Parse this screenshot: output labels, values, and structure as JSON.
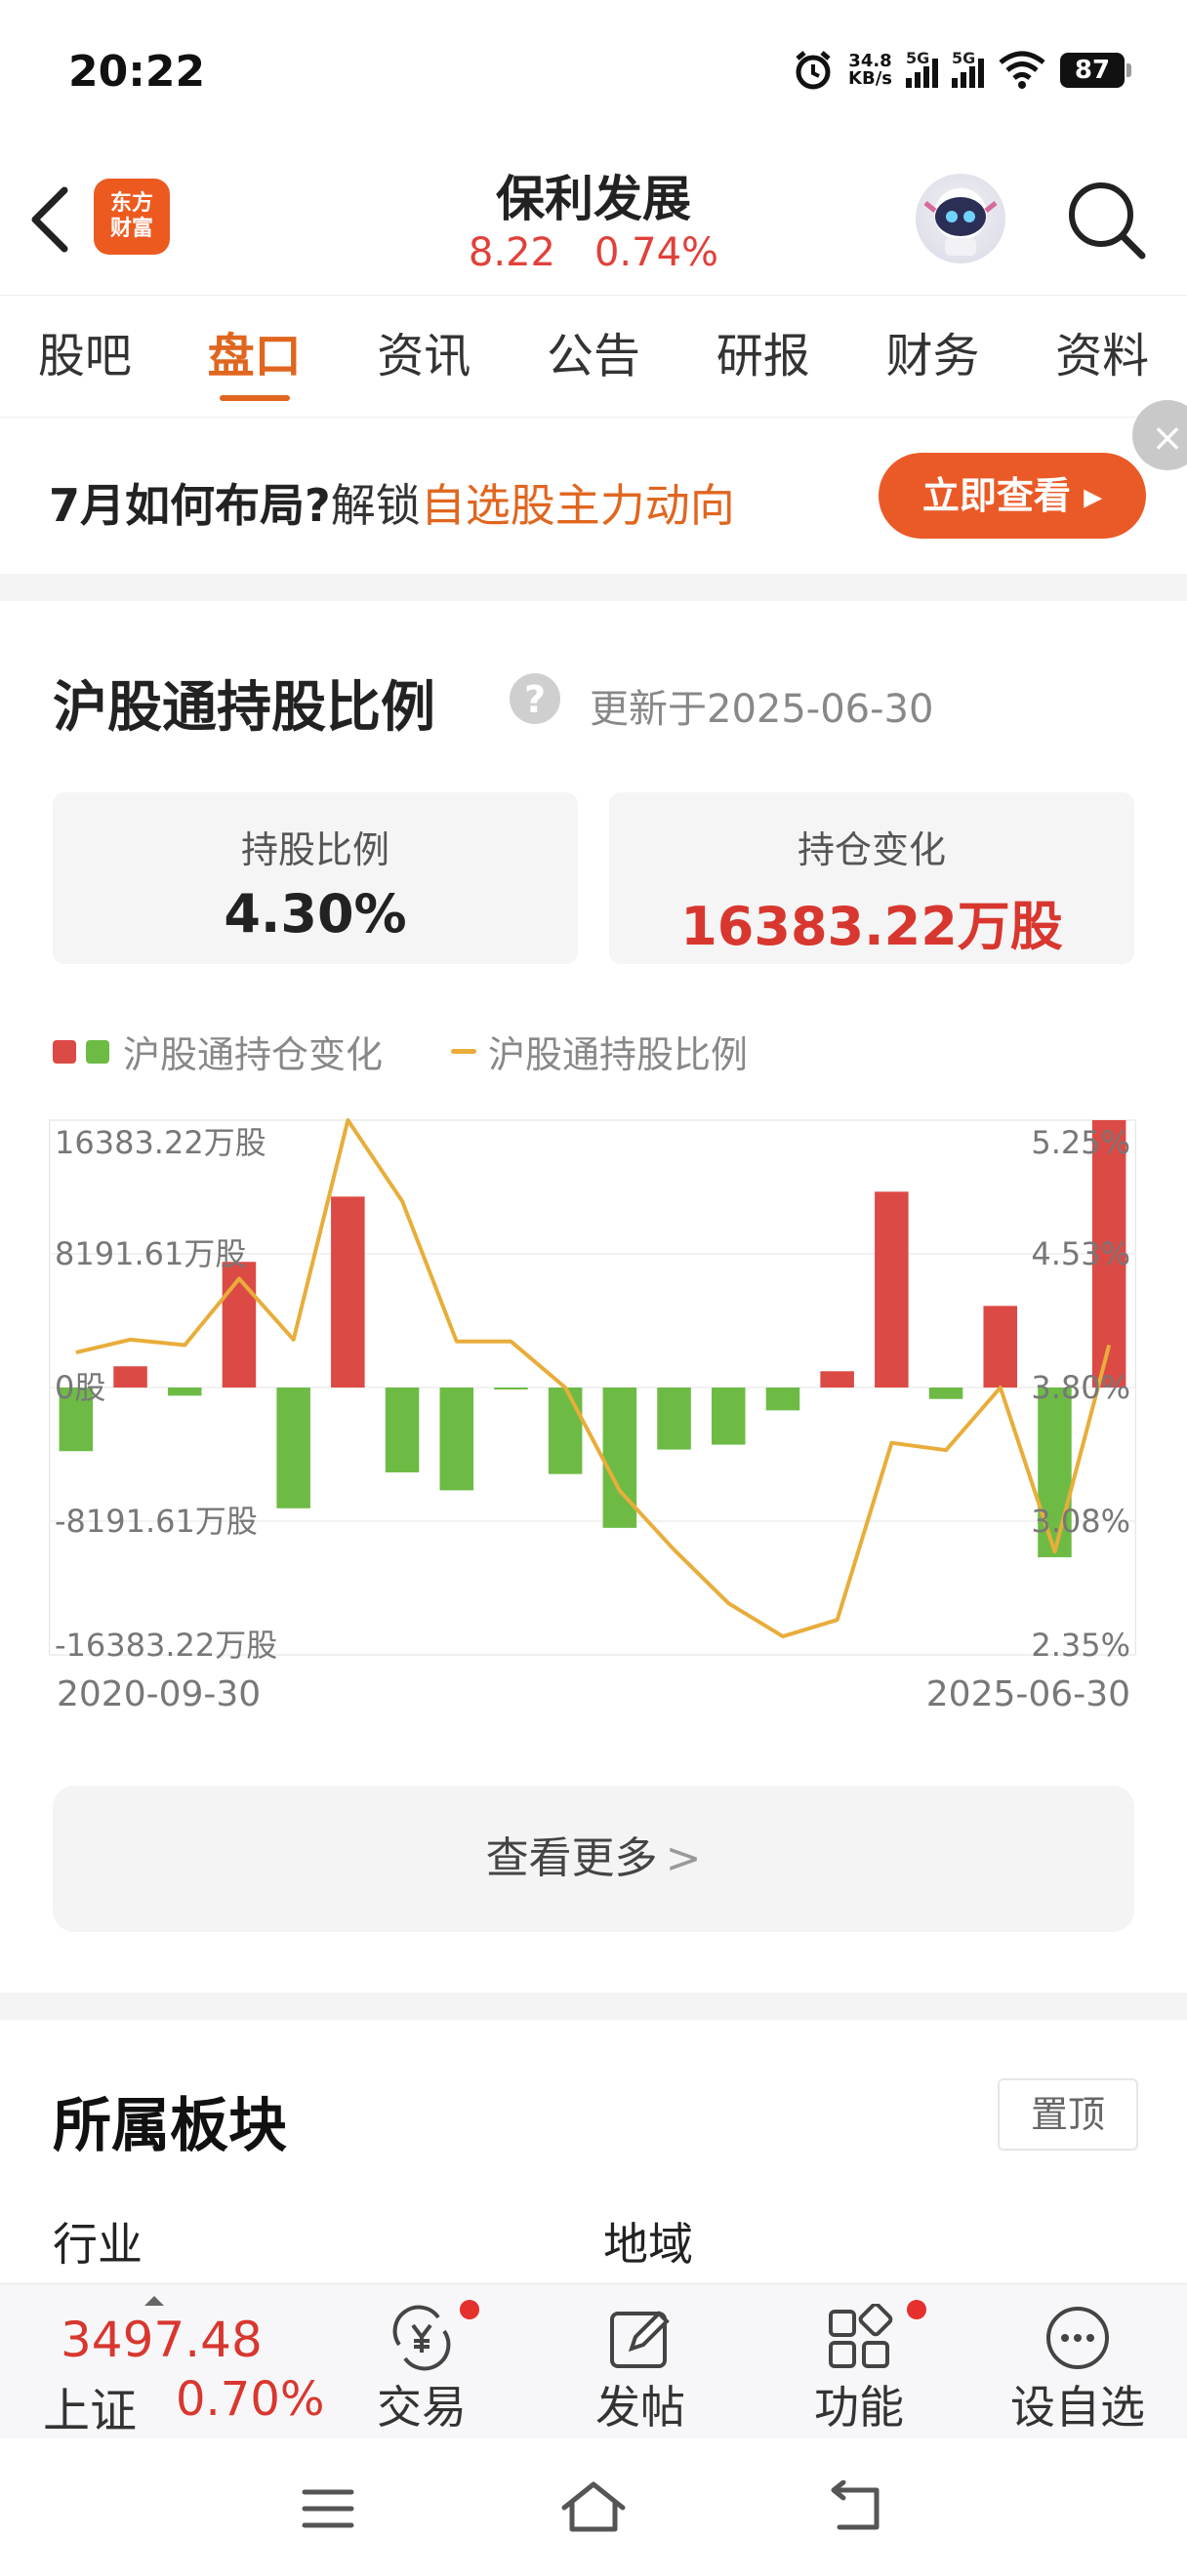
{
  "status": {
    "time": "20:22",
    "net_speed_value": "34.8",
    "net_speed_unit": "KB/s",
    "sim1": "5G",
    "sim2": "5G",
    "battery": "87"
  },
  "header": {
    "logo_line1": "东方",
    "logo_line2": "财富",
    "stock_name": "保利发展",
    "price": "8.22",
    "change_pct": "0.74%"
  },
  "tabs": [
    "股吧",
    "盘口",
    "资讯",
    "公告",
    "研报",
    "财务",
    "资料"
  ],
  "banner": {
    "prefix": "7月如何布局?",
    "middle": "解锁",
    "highlight": "自选股主力动向",
    "button": "立即查看 ▸",
    "close": "×"
  },
  "hsgt": {
    "title": "沪股通持股比例",
    "help": "?",
    "updated": "更新于2025-06-30",
    "card_ratio_label": "持股比例",
    "card_ratio_value": "4.30%",
    "card_change_label": "持仓变化",
    "card_change_value": "16383.22万股",
    "legend_bar": "沪股通持仓变化",
    "legend_line": "沪股通持股比例",
    "more": "查看更多"
  },
  "chart_data": {
    "type": "bar+line",
    "series": [
      {
        "name": "沪股通持仓变化",
        "type": "bar",
        "unit": "万股",
        "values": [
          -3900,
          1300,
          -500,
          7700,
          -7400,
          11700,
          -5200,
          -6300,
          -100,
          -5300,
          -8600,
          -3800,
          -3500,
          -1400,
          1000,
          12000,
          -700,
          5000,
          -10400,
          16383.22
        ]
      },
      {
        "name": "沪股通持股比例",
        "type": "line",
        "unit": "%",
        "values": [
          3.99,
          4.06,
          4.03,
          4.39,
          4.06,
          5.25,
          4.81,
          4.05,
          4.05,
          3.8,
          3.24,
          2.92,
          2.63,
          2.45,
          2.54,
          3.5,
          3.46,
          3.8,
          2.91,
          4.03
        ]
      }
    ],
    "x_start_label": "2020-09-30",
    "x_end_label": "2025-06-30",
    "left_ticks": [
      "16383.22万股",
      "8191.61万股",
      "0股",
      "-8191.61万股",
      "-16383.22万股"
    ],
    "right_ticks": [
      "5.25%",
      "4.53%",
      "3.80%",
      "3.08%",
      "2.35%"
    ],
    "left_range": [
      -16383.22,
      16383.22
    ],
    "right_range": [
      2.35,
      5.25
    ],
    "colors": {
      "positive": "#dc4a45",
      "negative": "#6dbb45",
      "line": "#e8ad3a"
    }
  },
  "sector": {
    "title": "所属板块",
    "pin": "置顶",
    "industry": "行业",
    "region": "地域"
  },
  "bottom": {
    "index_value": "3497.48",
    "index_name": "上证",
    "index_change": "0.70%",
    "nav": [
      {
        "label": "交易",
        "icon": "trade-yuan-icon"
      },
      {
        "label": "发帖",
        "icon": "edit-post-icon"
      },
      {
        "label": "功能",
        "icon": "grid-apps-icon"
      },
      {
        "label": "设自选",
        "icon": "more-dots-icon"
      }
    ]
  }
}
